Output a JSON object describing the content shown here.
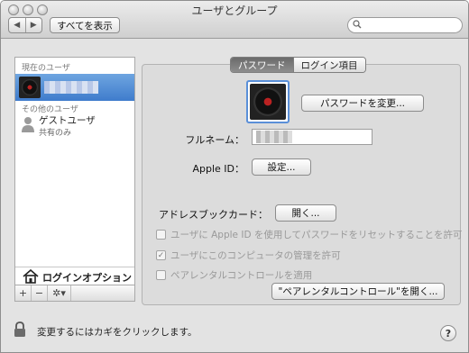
{
  "window": {
    "title": "ユーザとグループ"
  },
  "toolbar": {
    "back_icon": "chevron-left-icon",
    "forward_icon": "chevron-right-icon",
    "show_all_label": "すべてを表示",
    "search_placeholder": ""
  },
  "sidebar": {
    "current_users_header": "現在のユーザ",
    "other_users_header": "その他のユーザ",
    "guest": {
      "name": "ゲストユーザ",
      "subtitle": "共有のみ"
    },
    "login_options_label": "ログインオプション",
    "footer": {
      "add_label": "+",
      "remove_label": "−",
      "action_label": "✲▾"
    }
  },
  "tabs": [
    {
      "label": "パスワード",
      "active": true
    },
    {
      "label": "ログイン項目",
      "active": false
    }
  ],
  "main": {
    "change_password_label": "パスワードを変更...",
    "full_name_label": "フルネーム：",
    "apple_id_label": "Apple ID：",
    "apple_id_button": "設定...",
    "address_book_label": "アドレスブックカード：",
    "address_book_button": "開く...",
    "reset_with_appleid_label": "ユーザに Apple ID を使用してパスワードをリセットすることを許可",
    "admin_allowed_label": "ユーザにこのコンピュータの管理を許可",
    "parental_controls_label": "ペアレンタルコントロールを適用",
    "open_parental_button": "\"ペアレンタルコントロール\"を開く..."
  },
  "checkboxes": {
    "reset_with_appleid": false,
    "admin_allowed": true,
    "parental_controls": false
  },
  "bottom": {
    "lock_text": "変更するにはカギをクリックします。",
    "help_label": "?"
  },
  "colors": {
    "selection": "#3f7ccc",
    "panel": "#dcdcdc"
  }
}
